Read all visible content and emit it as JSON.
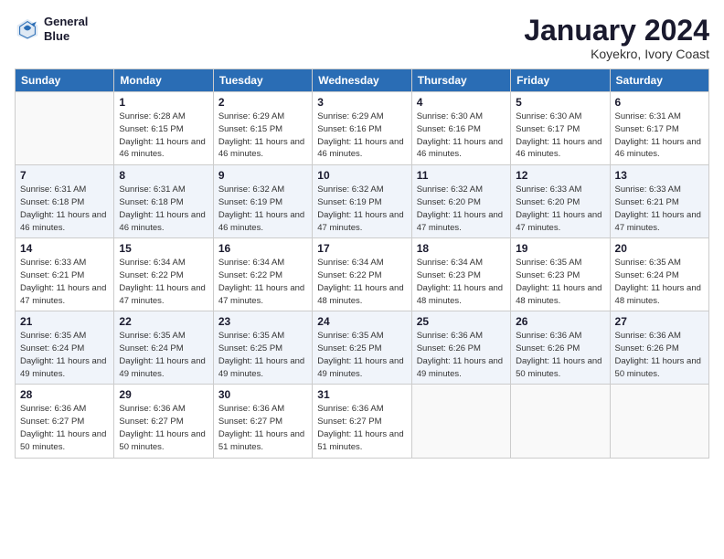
{
  "logo": {
    "line1": "General",
    "line2": "Blue"
  },
  "title": "January 2024",
  "subtitle": "Koyekro, Ivory Coast",
  "days_of_week": [
    "Sunday",
    "Monday",
    "Tuesday",
    "Wednesday",
    "Thursday",
    "Friday",
    "Saturday"
  ],
  "weeks": [
    [
      {
        "day": "",
        "empty": true
      },
      {
        "day": "1",
        "sunrise": "6:28 AM",
        "sunset": "6:15 PM",
        "daylight": "11 hours and 46 minutes."
      },
      {
        "day": "2",
        "sunrise": "6:29 AM",
        "sunset": "6:15 PM",
        "daylight": "11 hours and 46 minutes."
      },
      {
        "day": "3",
        "sunrise": "6:29 AM",
        "sunset": "6:16 PM",
        "daylight": "11 hours and 46 minutes."
      },
      {
        "day": "4",
        "sunrise": "6:30 AM",
        "sunset": "6:16 PM",
        "daylight": "11 hours and 46 minutes."
      },
      {
        "day": "5",
        "sunrise": "6:30 AM",
        "sunset": "6:17 PM",
        "daylight": "11 hours and 46 minutes."
      },
      {
        "day": "6",
        "sunrise": "6:31 AM",
        "sunset": "6:17 PM",
        "daylight": "11 hours and 46 minutes."
      }
    ],
    [
      {
        "day": "7",
        "sunrise": "6:31 AM",
        "sunset": "6:18 PM",
        "daylight": "11 hours and 46 minutes."
      },
      {
        "day": "8",
        "sunrise": "6:31 AM",
        "sunset": "6:18 PM",
        "daylight": "11 hours and 46 minutes."
      },
      {
        "day": "9",
        "sunrise": "6:32 AM",
        "sunset": "6:19 PM",
        "daylight": "11 hours and 46 minutes."
      },
      {
        "day": "10",
        "sunrise": "6:32 AM",
        "sunset": "6:19 PM",
        "daylight": "11 hours and 47 minutes."
      },
      {
        "day": "11",
        "sunrise": "6:32 AM",
        "sunset": "6:20 PM",
        "daylight": "11 hours and 47 minutes."
      },
      {
        "day": "12",
        "sunrise": "6:33 AM",
        "sunset": "6:20 PM",
        "daylight": "11 hours and 47 minutes."
      },
      {
        "day": "13",
        "sunrise": "6:33 AM",
        "sunset": "6:21 PM",
        "daylight": "11 hours and 47 minutes."
      }
    ],
    [
      {
        "day": "14",
        "sunrise": "6:33 AM",
        "sunset": "6:21 PM",
        "daylight": "11 hours and 47 minutes."
      },
      {
        "day": "15",
        "sunrise": "6:34 AM",
        "sunset": "6:22 PM",
        "daylight": "11 hours and 47 minutes."
      },
      {
        "day": "16",
        "sunrise": "6:34 AM",
        "sunset": "6:22 PM",
        "daylight": "11 hours and 47 minutes."
      },
      {
        "day": "17",
        "sunrise": "6:34 AM",
        "sunset": "6:22 PM",
        "daylight": "11 hours and 48 minutes."
      },
      {
        "day": "18",
        "sunrise": "6:34 AM",
        "sunset": "6:23 PM",
        "daylight": "11 hours and 48 minutes."
      },
      {
        "day": "19",
        "sunrise": "6:35 AM",
        "sunset": "6:23 PM",
        "daylight": "11 hours and 48 minutes."
      },
      {
        "day": "20",
        "sunrise": "6:35 AM",
        "sunset": "6:24 PM",
        "daylight": "11 hours and 48 minutes."
      }
    ],
    [
      {
        "day": "21",
        "sunrise": "6:35 AM",
        "sunset": "6:24 PM",
        "daylight": "11 hours and 49 minutes."
      },
      {
        "day": "22",
        "sunrise": "6:35 AM",
        "sunset": "6:24 PM",
        "daylight": "11 hours and 49 minutes."
      },
      {
        "day": "23",
        "sunrise": "6:35 AM",
        "sunset": "6:25 PM",
        "daylight": "11 hours and 49 minutes."
      },
      {
        "day": "24",
        "sunrise": "6:35 AM",
        "sunset": "6:25 PM",
        "daylight": "11 hours and 49 minutes."
      },
      {
        "day": "25",
        "sunrise": "6:36 AM",
        "sunset": "6:26 PM",
        "daylight": "11 hours and 49 minutes."
      },
      {
        "day": "26",
        "sunrise": "6:36 AM",
        "sunset": "6:26 PM",
        "daylight": "11 hours and 50 minutes."
      },
      {
        "day": "27",
        "sunrise": "6:36 AM",
        "sunset": "6:26 PM",
        "daylight": "11 hours and 50 minutes."
      }
    ],
    [
      {
        "day": "28",
        "sunrise": "6:36 AM",
        "sunset": "6:27 PM",
        "daylight": "11 hours and 50 minutes."
      },
      {
        "day": "29",
        "sunrise": "6:36 AM",
        "sunset": "6:27 PM",
        "daylight": "11 hours and 50 minutes."
      },
      {
        "day": "30",
        "sunrise": "6:36 AM",
        "sunset": "6:27 PM",
        "daylight": "11 hours and 51 minutes."
      },
      {
        "day": "31",
        "sunrise": "6:36 AM",
        "sunset": "6:27 PM",
        "daylight": "11 hours and 51 minutes."
      },
      {
        "day": "",
        "empty": true
      },
      {
        "day": "",
        "empty": true
      },
      {
        "day": "",
        "empty": true
      }
    ]
  ],
  "labels": {
    "sunrise_prefix": "Sunrise: ",
    "sunset_prefix": "Sunset: ",
    "daylight_prefix": "Daylight: "
  }
}
